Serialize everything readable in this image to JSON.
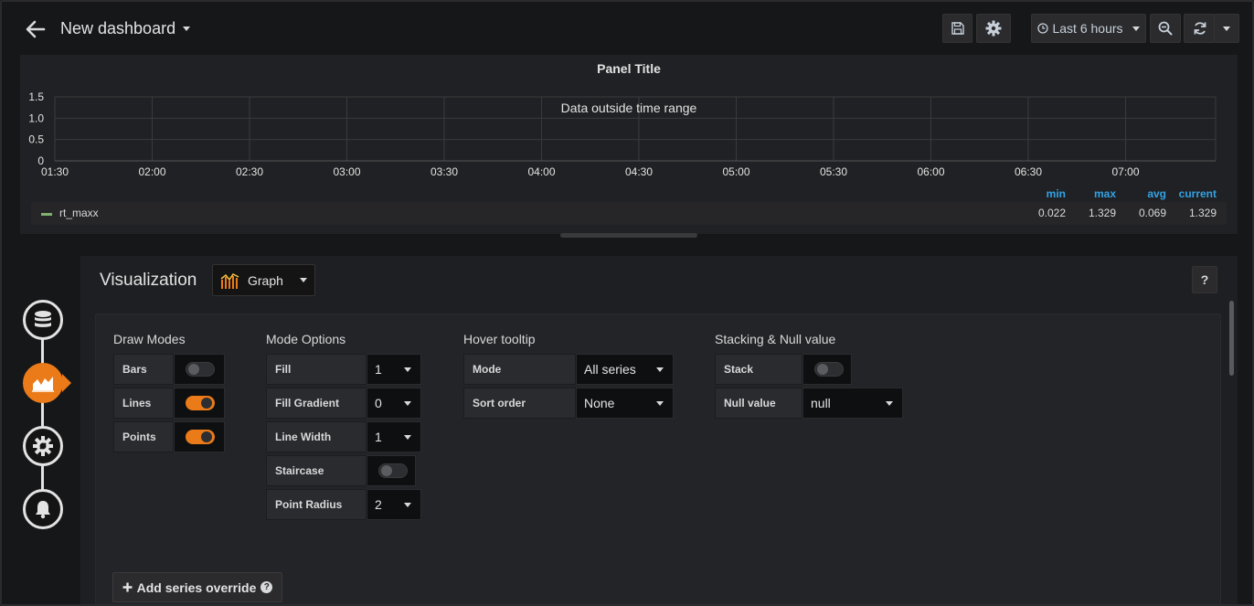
{
  "header": {
    "title": "New dashboard",
    "time_range": "Last 6 hours"
  },
  "panel": {
    "title": "Panel Title",
    "message": "Data outside time range"
  },
  "chart_data": {
    "type": "line",
    "title": "Panel Title",
    "annotation": "Data outside time range",
    "y_ticks": [
      "1.5",
      "1.0",
      "0.5",
      "0"
    ],
    "x_ticks": [
      "01:30",
      "02:00",
      "02:30",
      "03:00",
      "03:30",
      "04:00",
      "04:30",
      "05:00",
      "05:30",
      "06:00",
      "06:30",
      "07:00"
    ],
    "ylim": [
      0,
      1.5
    ],
    "grid": true,
    "series": [
      {
        "name": "rt_maxx",
        "color": "#7eb26d",
        "min": "0.022",
        "max": "1.329",
        "avg": "0.069",
        "current": "1.329"
      }
    ],
    "legend_columns": [
      "min",
      "max",
      "avg",
      "current"
    ],
    "legend_placement": "bottom"
  },
  "editor": {
    "visualization_label": "Visualization",
    "visualization_type": "Graph",
    "help": "?",
    "sections": {
      "draw_modes": {
        "title": "Draw Modes",
        "bars": {
          "label": "Bars",
          "on": false
        },
        "lines": {
          "label": "Lines",
          "on": true
        },
        "points": {
          "label": "Points",
          "on": true
        }
      },
      "mode_options": {
        "title": "Mode Options",
        "fill": {
          "label": "Fill",
          "value": "1"
        },
        "fill_gradient": {
          "label": "Fill Gradient",
          "value": "0"
        },
        "line_width": {
          "label": "Line Width",
          "value": "1"
        },
        "staircase": {
          "label": "Staircase",
          "on": false
        },
        "point_radius": {
          "label": "Point Radius",
          "value": "2"
        }
      },
      "hover_tooltip": {
        "title": "Hover tooltip",
        "mode": {
          "label": "Mode",
          "value": "All series"
        },
        "sort_order": {
          "label": "Sort order",
          "value": "None"
        }
      },
      "stacking": {
        "title": "Stacking & Null value",
        "stack": {
          "label": "Stack",
          "on": false
        },
        "null_value": {
          "label": "Null value",
          "value": "null"
        }
      }
    },
    "add_override": "Add series override"
  },
  "colors": {
    "accent": "#eb7b18",
    "legend_header": "#33a2e5",
    "background": "#161719"
  }
}
